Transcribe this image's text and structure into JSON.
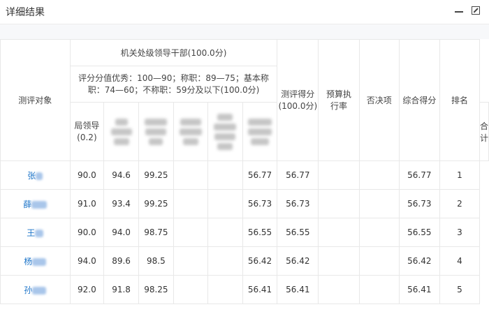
{
  "panel": {
    "title": "详细结果"
  },
  "table": {
    "h_object": "测评对象",
    "h_group": "机关处级领导干部(100.0分)",
    "h_criteria": "评分分值优秀：100—90；称职：89—75；基本称职：74—60；不称职：59分及以下(100.0分)",
    "h_bureau": "局领导(0.2)",
    "h_total": "合计",
    "h_score": "测评得分(100.0分)",
    "h_budget": "预算执行率",
    "h_veto": "否决项",
    "h_overall": "综合得分",
    "h_rank": "排名",
    "rows": [
      {
        "name": "张",
        "v1": "90.0",
        "v2": "94.6",
        "v3": "99.25",
        "total": "56.77",
        "score": "56.77",
        "overall": "56.77",
        "rank": "1"
      },
      {
        "name": "薛",
        "v1": "91.0",
        "v2": "93.4",
        "v3": "99.25",
        "total": "56.73",
        "score": "56.73",
        "overall": "56.73",
        "rank": "2"
      },
      {
        "name": "王",
        "v1": "90.0",
        "v2": "94.0",
        "v3": "98.75",
        "total": "56.55",
        "score": "56.55",
        "overall": "56.55",
        "rank": "3"
      },
      {
        "name": "杨",
        "v1": "94.0",
        "v2": "89.6",
        "v3": "98.5",
        "total": "56.42",
        "score": "56.42",
        "overall": "56.42",
        "rank": "4"
      },
      {
        "name": "孙",
        "v1": "92.0",
        "v2": "91.8",
        "v3": "98.25",
        "total": "56.41",
        "score": "56.41",
        "overall": "56.41",
        "rank": "5"
      }
    ]
  }
}
